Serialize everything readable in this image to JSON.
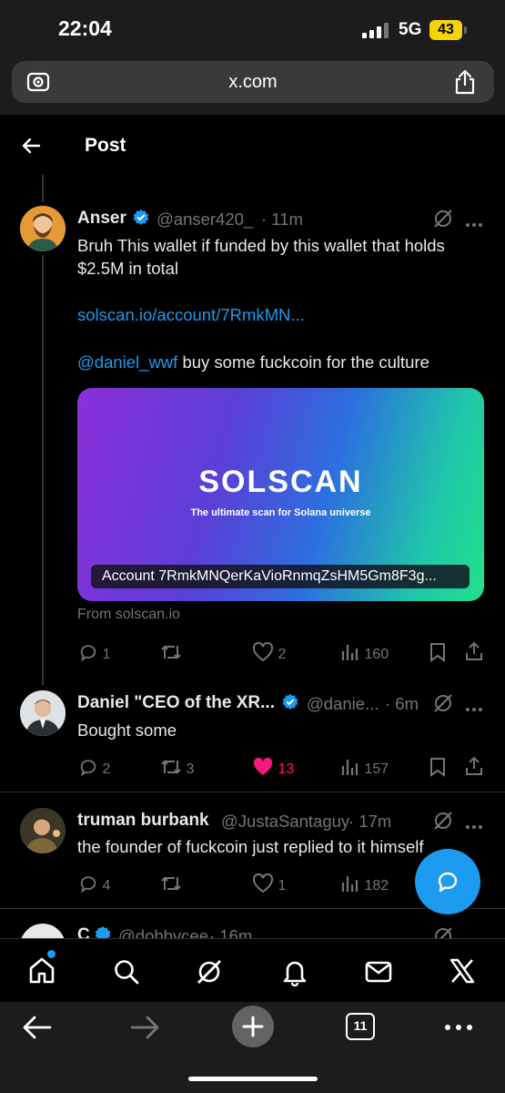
{
  "status_bar": {
    "time": "22:04",
    "network": "5G",
    "battery": "43"
  },
  "browser": {
    "url": "x.com",
    "tab_count": "11"
  },
  "header": {
    "title": "Post"
  },
  "posts": [
    {
      "name": "Anser",
      "handle": "@anser420_",
      "time": "· 11m",
      "text_line1": "Bruh This wallet if funded by this wallet that holds",
      "text_line2": "$2.5M in total",
      "link": "solscan.io/account/7RmkMN...",
      "mention": "@daniel_wwf",
      "mention_rest": " buy some fuckcoin for the culture",
      "card": {
        "logo": "SOLSCAN",
        "tagline": "The ultimate scan for Solana universe",
        "caption": "Account 7RmkMNQerKaVioRnmqZsHM5Gm8F3g..."
      },
      "from": "From solscan.io",
      "replies": "1",
      "reposts": "",
      "likes": "2",
      "views": "160"
    },
    {
      "name": "Daniel \"CEO of the XR...",
      "handle": "@danie...",
      "time": "· 6m",
      "text": "Bought some",
      "replies": "2",
      "reposts": "3",
      "likes": "13",
      "views": "157"
    },
    {
      "name": "truman burbank",
      "handle": "@JustaSantaguy",
      "time": "· 17m",
      "text": "the founder of fuckcoin just replied to it himself",
      "replies": "4",
      "reposts": "",
      "likes": "1",
      "views": "182"
    },
    {
      "name": "C",
      "handle": "@dobbycee",
      "time": "· 16m"
    }
  ],
  "colors": {
    "accent": "#1d9bf0",
    "like_active": "#f91880",
    "background": "#000000"
  }
}
